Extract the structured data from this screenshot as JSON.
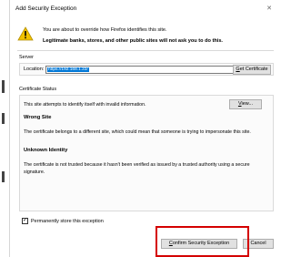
{
  "dialog": {
    "title": "Add Security Exception",
    "close_glyph": "✕",
    "message_line1": "You are about to override how Firefox identifies this site.",
    "message_line2": "Legitimate banks, stores, and other public sites will not ask you to do this.",
    "warning_icon": "warning-triangle-icon"
  },
  "server": {
    "label": "Server",
    "location_label": "Location:",
    "location_value": "https://192.168.1.22/",
    "get_cert_prefix": "G",
    "get_cert_rest": "et Certificate"
  },
  "status": {
    "label": "Certificate Status",
    "intro": "This site attempts to identify itself with invalid information.",
    "view_prefix": "V",
    "view_rest": "iew...",
    "wrong_site_heading": "Wrong Site",
    "wrong_site_text": "The certificate belongs to a different site, which could mean that someone is trying to impersonate this site.",
    "unknown_heading": "Unknown Identity",
    "unknown_text": "The certificate is not trusted because it hasn't been verified as issued by a trusted authority using a secure signature."
  },
  "footer": {
    "permanent_prefix": "P",
    "permanent_rest": "ermanently store this exception",
    "permanent_checked": true,
    "confirm_prefix": "C",
    "confirm_rest": "onfirm Security Exception",
    "cancel_label": "Cancel"
  },
  "colors": {
    "highlight": "#d40000",
    "selection": "#0078d7",
    "warning": "#f2c200"
  }
}
